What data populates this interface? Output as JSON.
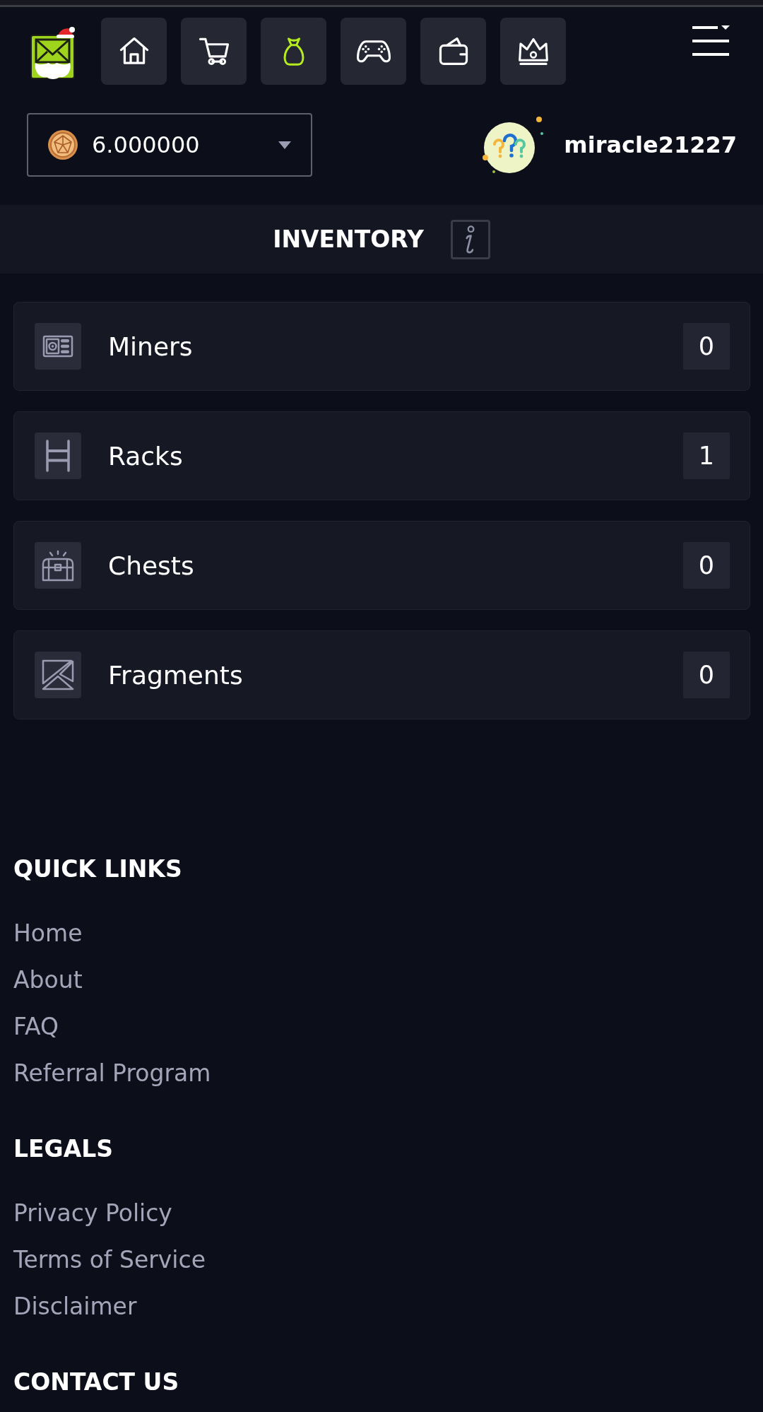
{
  "nav": {
    "items": [
      {
        "kind": "home",
        "selected": false
      },
      {
        "kind": "cart",
        "selected": false
      },
      {
        "kind": "bag",
        "selected": true
      },
      {
        "kind": "gamepad",
        "selected": false
      },
      {
        "kind": "wallet",
        "selected": false
      },
      {
        "kind": "crown",
        "selected": false
      }
    ]
  },
  "balance": {
    "value": "6.000000"
  },
  "user": {
    "name": "miracle21227"
  },
  "inventory": {
    "title": "INVENTORY",
    "items": [
      {
        "kind": "miner",
        "label": "Miners",
        "count": "0"
      },
      {
        "kind": "rack",
        "label": "Racks",
        "count": "1"
      },
      {
        "kind": "chest",
        "label": "Chests",
        "count": "0"
      },
      {
        "kind": "fragment",
        "label": "Fragments",
        "count": "0"
      }
    ]
  },
  "footer": {
    "sections": [
      {
        "title": "QUICK LINKS",
        "links": [
          "Home",
          "About",
          "FAQ",
          "Referral Program"
        ]
      },
      {
        "title": "LEGALS",
        "links": [
          "Privacy Policy",
          "Terms of Service",
          "Disclaimer"
        ]
      },
      {
        "title": "CONTACT US"
      }
    ]
  }
}
